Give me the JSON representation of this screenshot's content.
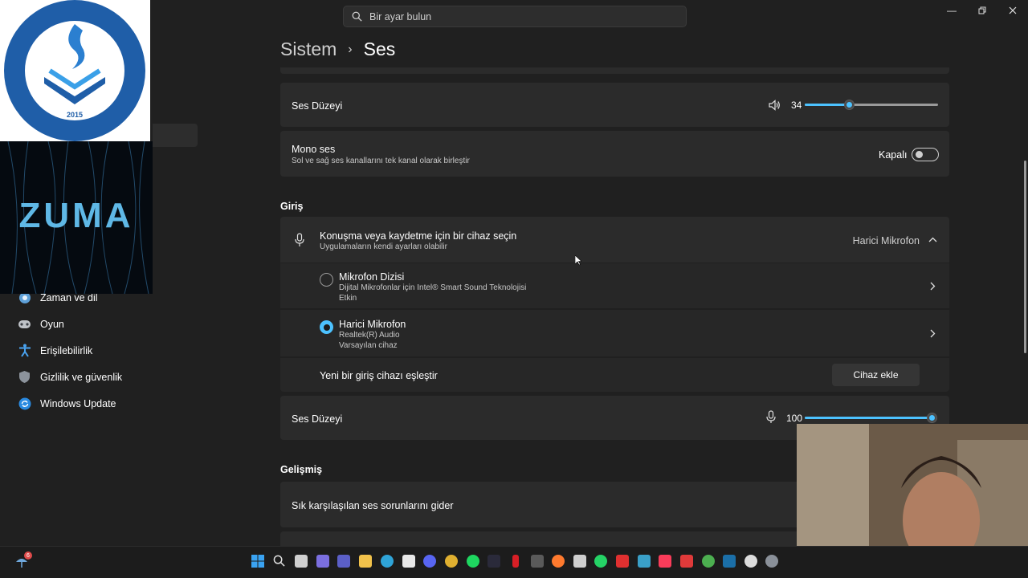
{
  "search": {
    "placeholder": "Bir ayar bulun"
  },
  "breadcrumb": {
    "parent": "Sistem",
    "separator": "›",
    "current": "Ses"
  },
  "output_volume": {
    "label": "Ses Düzeyi",
    "value": "34",
    "level_percent": 34
  },
  "mono": {
    "title": "Mono ses",
    "subtitle": "Sol ve sağ ses kanallarını tek kanal olarak birleştir",
    "state": "Kapalı"
  },
  "input_section": {
    "title": "Giriş"
  },
  "input_device": {
    "title": "Konuşma veya kaydetme için bir cihaz seçin",
    "subtitle": "Uygulamaların kendi ayarları olabilir",
    "selected": "Harici Mikrofon"
  },
  "devices": [
    {
      "name": "Mikrofon Dizisi",
      "detail": "Dijital Mikrofonlar için Intel® Smart Sound Teknolojisi",
      "status": "Etkin",
      "selected": false
    },
    {
      "name": "Harici Mikrofon",
      "detail": "Realtek(R) Audio",
      "status": "Varsayılan cihaz",
      "selected": true
    }
  ],
  "pair": {
    "label": "Yeni bir giriş cihazı eşleştir",
    "button": "Cihaz ekle"
  },
  "input_volume": {
    "label": "Ses Düzeyi",
    "value": "100",
    "level_percent": 100
  },
  "advanced": {
    "title": "Gelişmiş",
    "troubleshoot": "Sık karşılaşılan ses sorunlarını gider"
  },
  "sidebar": {
    "items": [
      {
        "label": "Zaman ve dil",
        "icon": "globe-clock-icon"
      },
      {
        "label": "Oyun",
        "icon": "gamepad-icon"
      },
      {
        "label": "Erişilebilirlik",
        "icon": "accessibility-icon"
      },
      {
        "label": "Gizlilik ve güvenlik",
        "icon": "shield-icon"
      },
      {
        "label": "Windows Update",
        "icon": "update-icon"
      }
    ]
  },
  "overlays": {
    "zuma_text": "ZUMA",
    "logo_year": "2015"
  },
  "taskbar": {
    "weather_badge": "6"
  },
  "colors": {
    "accent": "#4cc2ff",
    "background": "#202020",
    "card": "#2b2b2b"
  }
}
